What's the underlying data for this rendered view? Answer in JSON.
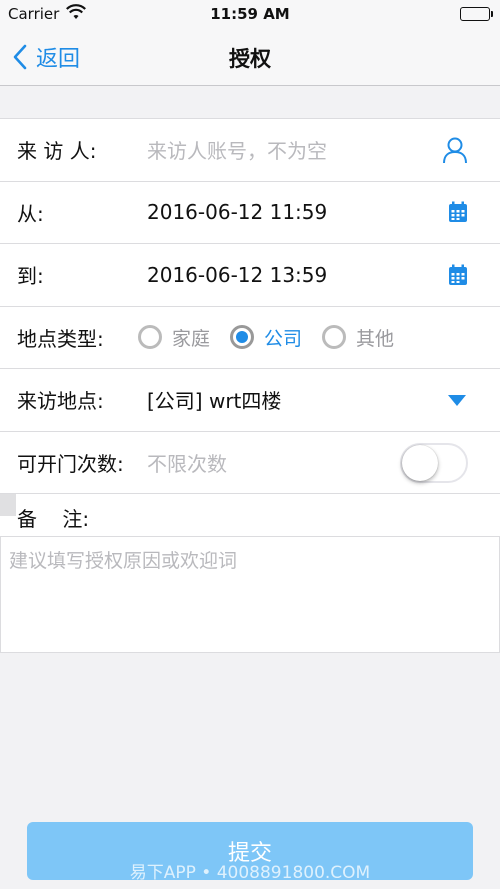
{
  "status_bar": {
    "carrier": "Carrier",
    "time": "11:59 AM"
  },
  "nav": {
    "back_label": "返回",
    "title": "授权"
  },
  "form": {
    "visitor": {
      "label": "来 访 人:",
      "placeholder": "来访人账号，不为空"
    },
    "from": {
      "label": "从:",
      "value": "2016-06-12 11:59"
    },
    "to": {
      "label": "到:",
      "value": "2016-06-12 13:59"
    },
    "location_type": {
      "label": "地点类型:",
      "options": [
        "家庭",
        "公司",
        "其他"
      ],
      "selected": "公司"
    },
    "location": {
      "label": "来访地点:",
      "value": "[公司] wrt四楼"
    },
    "open_count": {
      "label": "可开门次数:",
      "placeholder": "不限次数",
      "toggle_on": false
    },
    "notes": {
      "label": "备    注:",
      "placeholder": "建议填写授权原因或欢迎词"
    }
  },
  "submit_label": "提交",
  "watermark": "易下APP • 4008891800.COM",
  "colors": {
    "accent": "#1f8ce6",
    "submit_bg": "#7ec6f7"
  }
}
